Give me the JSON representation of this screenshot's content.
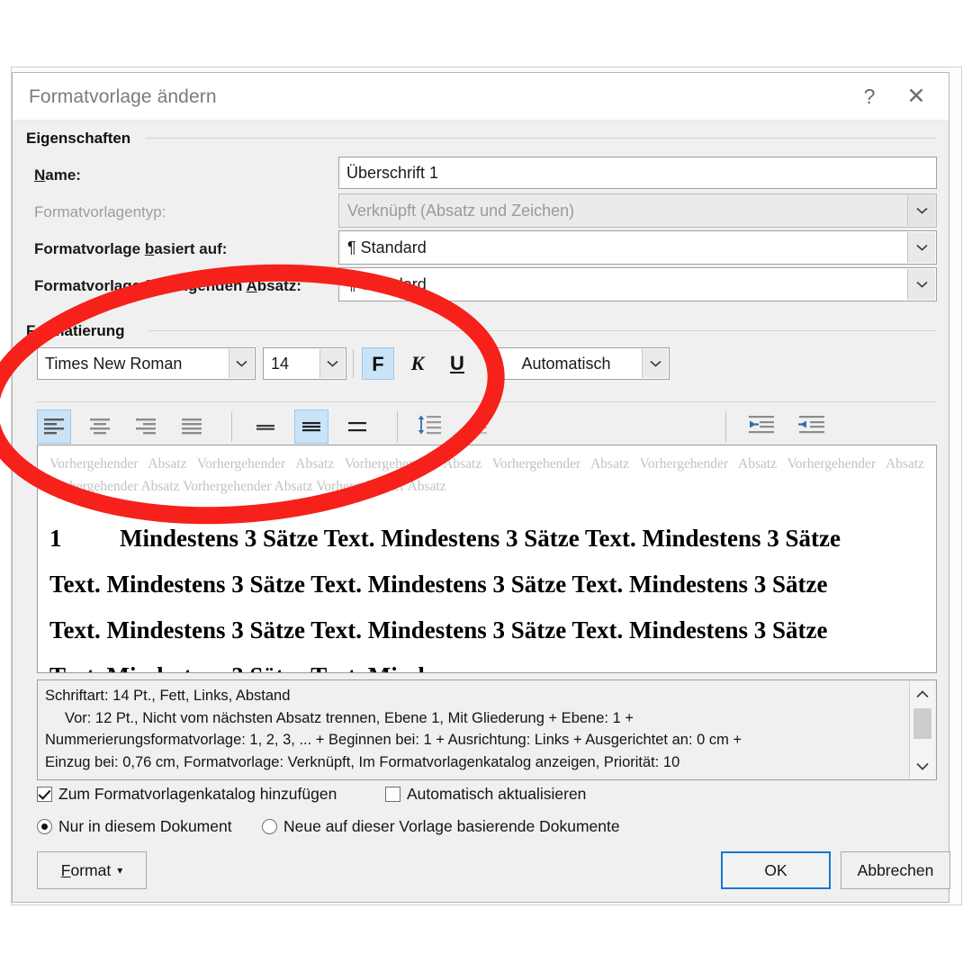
{
  "dialog": {
    "title": "Formatvorlage ändern",
    "help_icon": "?",
    "close_icon": "✕"
  },
  "properties": {
    "group_label": "Eigenschaften",
    "name_label": "Name:",
    "name_value": "Überschrift 1",
    "type_label": "Formatvorlagentyp:",
    "type_value": "Verknüpft (Absatz und Zeichen)",
    "based_on_label": "Formatvorlage basiert auf:",
    "based_on_value": "¶ Standard",
    "next_style_label": "Formatvorlage für folgenden Absatz:",
    "next_style_value": "¶ Standard"
  },
  "formatting": {
    "group_label": "Formatierung",
    "font_family": "Times New Roman",
    "font_size": "14",
    "bold_label": "F",
    "italic_label": "K",
    "underline_label": "U",
    "color_value": "Automatisch"
  },
  "preview": {
    "previous_paragraph": "Vorhergehender Absatz Vorhergehender Absatz Vorhergehender Absatz Vorhergehender Absatz Vorhergehender Absatz Vorhergehender Absatz Vorhergehender Absatz Vorhergehender Absatz Vorhergehender Absatz",
    "number": "1",
    "lines": [
      "Mindestens 3 Sätze Text. Mindestens 3 Sätze Text. Mindestens 3 Sätze",
      "Text. Mindestens 3 Sätze Text. Mindestens 3 Sätze Text. Mindestens 3 Sätze",
      "Text. Mindestens 3 Sätze Text. Mindestens 3 Sätze Text. Mindestens 3 Sätze",
      "Text. Mindestens 3 Sätze Text. Mind"
    ]
  },
  "description": {
    "line1": "Schriftart: 14 Pt., Fett, Links, Abstand",
    "line2": "Vor:  12 Pt., Nicht vom nächsten Absatz trennen, Ebene 1, Mit Gliederung + Ebene: 1 +",
    "line3": "Nummerierungsformatvorlage: 1, 2, 3, ... + Beginnen bei: 1 + Ausrichtung: Links + Ausgerichtet an:  0 cm +",
    "line4": "Einzug bei:  0,76 cm, Formatvorlage: Verknüpft, Im Formatvorlagenkatalog anzeigen, Priorität: 10"
  },
  "options": {
    "add_to_gallery": "Zum Formatvorlagenkatalog hinzufügen",
    "add_to_gallery_checked": true,
    "auto_update": "Automatisch aktualisieren",
    "auto_update_checked": false,
    "only_this_document": "Nur in diesem Dokument",
    "only_this_document_selected": true,
    "new_documents": "Neue auf dieser Vorlage basierende Dokumente",
    "new_documents_selected": false
  },
  "footer": {
    "format_label": "Format",
    "format_caret": "▾",
    "ok_label": "OK",
    "cancel_label": "Abbrechen"
  },
  "annotation": {
    "shape": "ellipse",
    "color": "#F5211A"
  }
}
